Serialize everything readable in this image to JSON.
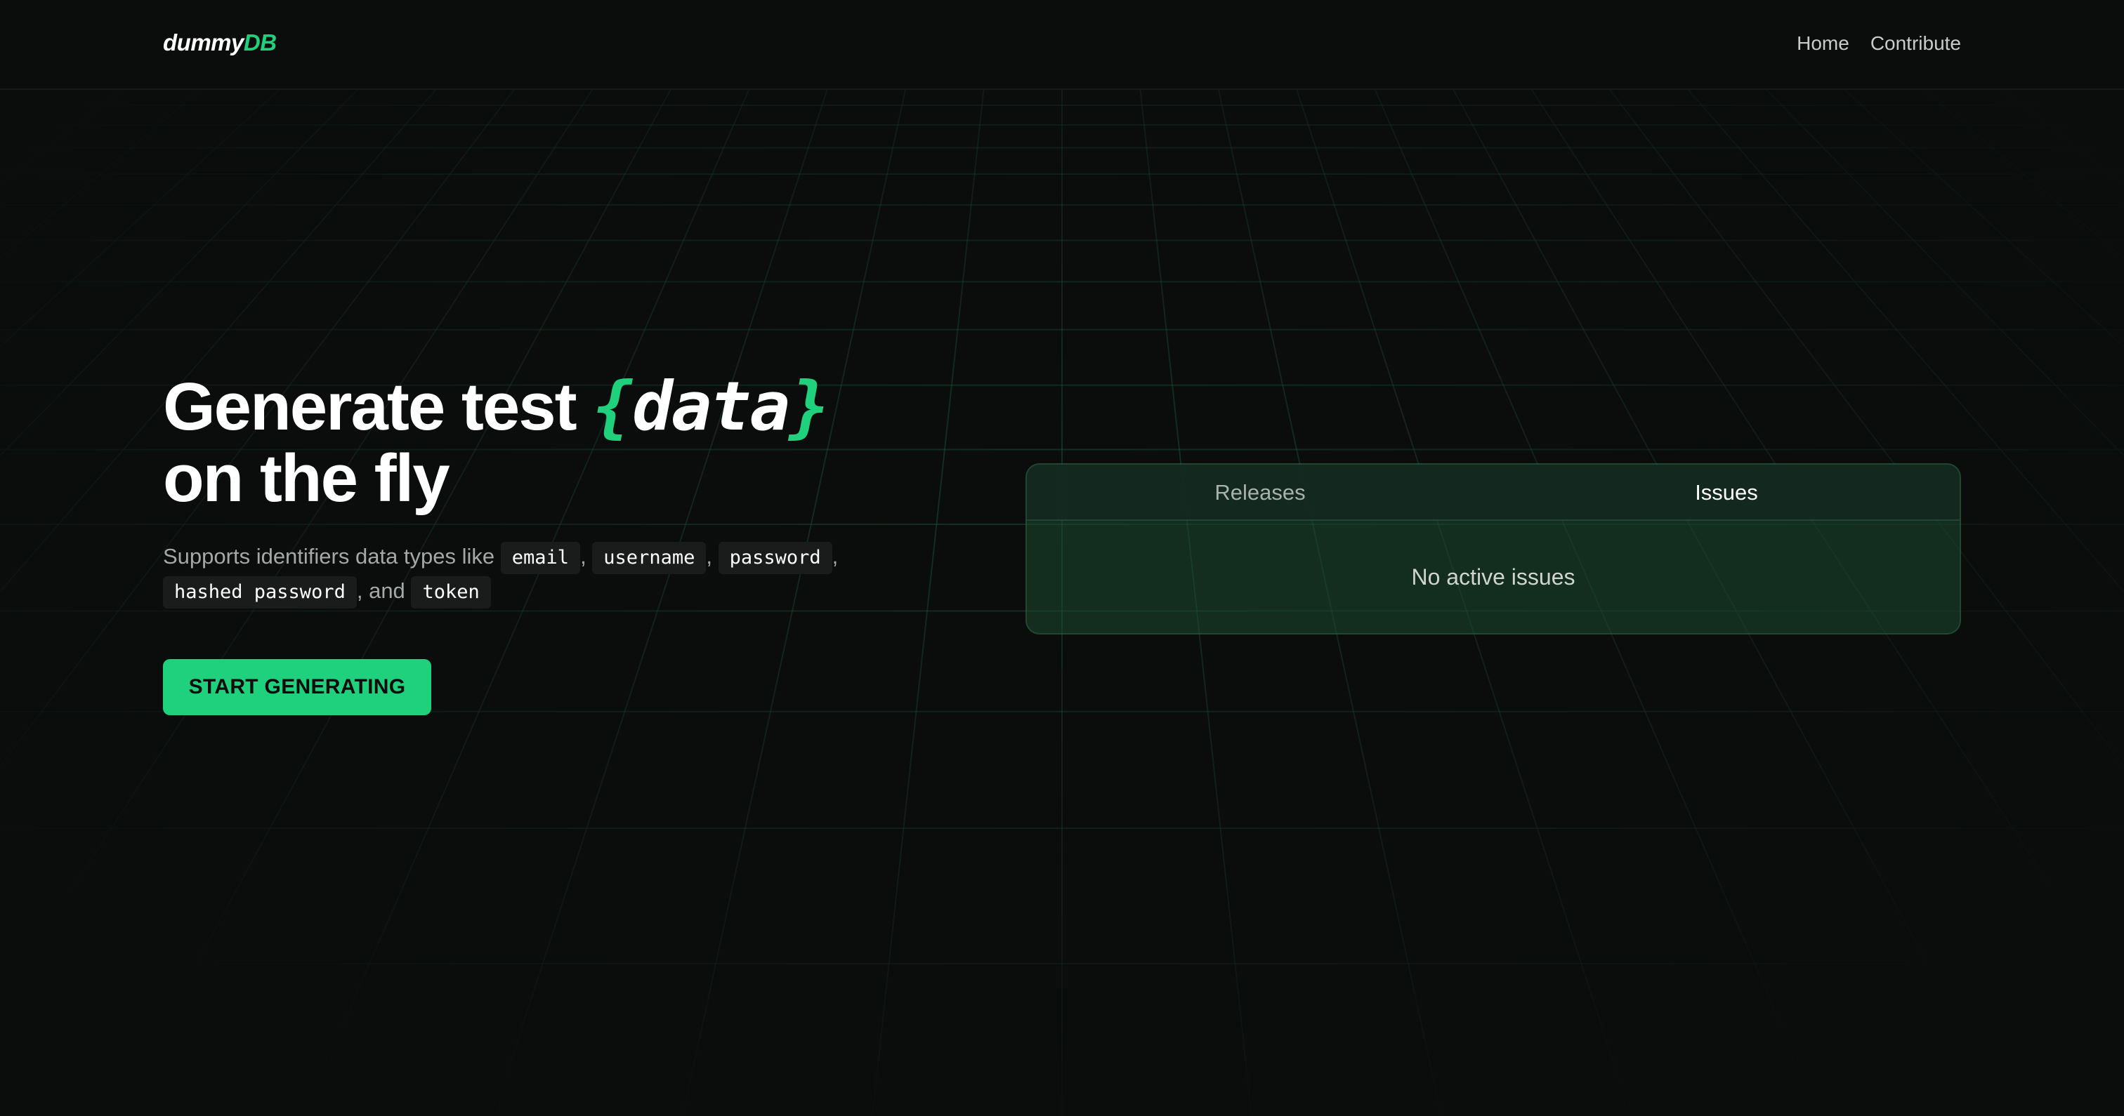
{
  "nav": {
    "logo_part1": "dummy",
    "logo_part2": "DB",
    "links": [
      "Home",
      "Contribute"
    ]
  },
  "hero": {
    "headline_part1": "Generate test",
    "brace_open": "{",
    "highlight": "data",
    "brace_close": "}",
    "headline_part2": "on the fly",
    "subtitle_prefix": "Supports identifiers data types like",
    "types": [
      "email",
      "username",
      "password",
      "hashed password",
      "token"
    ],
    "and_word": "and",
    "cta_label": "START GENERATING"
  },
  "panel": {
    "tabs": [
      "Releases",
      "Issues"
    ],
    "active_tab": "Issues",
    "empty_message": "No active issues"
  },
  "colors": {
    "accent": "#1fd07c",
    "background": "#0b0c0c"
  }
}
